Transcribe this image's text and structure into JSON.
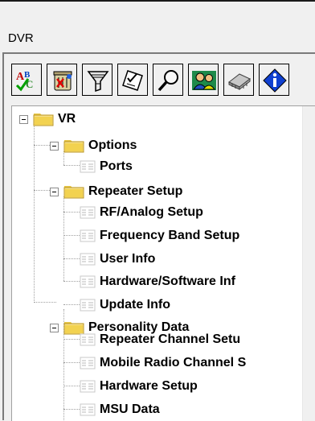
{
  "window": {
    "title": "DVR"
  },
  "toolbar": {
    "buttons": [
      {
        "icon": "spellcheck-abc-icon"
      },
      {
        "icon": "trash-bin-icon"
      },
      {
        "icon": "funnel-filter-icon"
      },
      {
        "icon": "checklist-icon"
      },
      {
        "icon": "magnifier-search-icon"
      },
      {
        "icon": "users-icon"
      },
      {
        "icon": "chip-icon"
      },
      {
        "icon": "info-icon"
      }
    ]
  },
  "tree": {
    "root": "VR",
    "groups": [
      {
        "label": "Options",
        "children": [
          "Ports"
        ]
      },
      {
        "label": "Repeater Setup",
        "children": [
          "RF/Analog Setup",
          "Frequency Band Setup",
          "User Info",
          "Hardware/Software Inf",
          "Update Info"
        ]
      },
      {
        "label": "Personality Data",
        "children": [
          "Repeater Channel Setu",
          "Mobile Radio Channel S",
          "Hardware Setup",
          "MSU Data"
        ]
      }
    ]
  }
}
